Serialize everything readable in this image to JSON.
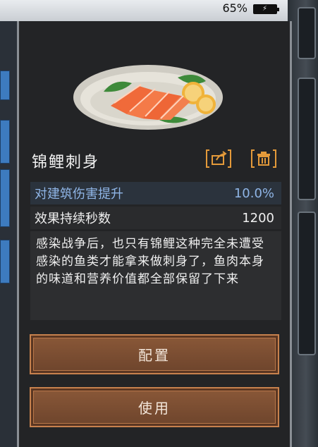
{
  "status_bar": {
    "battery_percent": "65%"
  },
  "item": {
    "name": "锦鲤刺身",
    "stats": [
      {
        "label": "对建筑伤害提升",
        "value": "10.0%"
      },
      {
        "label": "效果持续秒数",
        "value": "1200"
      }
    ],
    "description": "感染战争后，也只有锦鲤这种完全未遭受感染的鱼类才能拿来做刺身了，鱼肉本身的味道和营养价值都全部保留了下来"
  },
  "actions": {
    "configure_label": "配置",
    "use_label": "使用"
  },
  "icons": {
    "share": "share-icon",
    "delete": "trash-icon",
    "battery": "battery-charging-icon"
  },
  "colors": {
    "accent_orange": "#e49a3a",
    "stat_highlight_blue": "#8fb5e6",
    "button_fill": "#7a4d31",
    "button_border": "#c7814d"
  }
}
